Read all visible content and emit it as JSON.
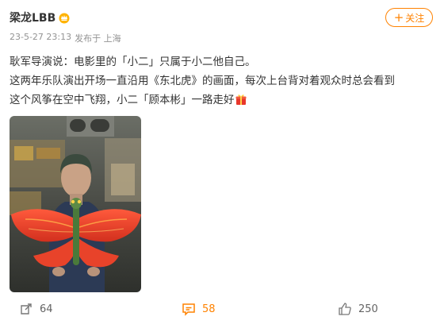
{
  "post": {
    "author": "梁龙LBB",
    "time": "23-5-27 23:13",
    "published_from": "发布于 上海",
    "follow_label": "关注",
    "lines": [
      "耿军导演说：电影里的「小二」只属于小二他自己。",
      "这两年乐队演出开场一直沿用《东北虎》的画面，每次上台背对着观众时总会看到",
      "这个风筝在空中飞翔，小二「顾本彬」一路走好"
    ]
  },
  "actions": {
    "repost_count": "64",
    "comment_count": "58",
    "like_count": "250"
  },
  "colors": {
    "accent": "#ff8200",
    "muted": "#939393",
    "text": "#333333"
  },
  "icons": {
    "badge": "crown-badge-icon",
    "gift": "gift-icon",
    "repost": "repost-icon",
    "comment": "comment-icon",
    "like": "thumbs-up-icon"
  }
}
